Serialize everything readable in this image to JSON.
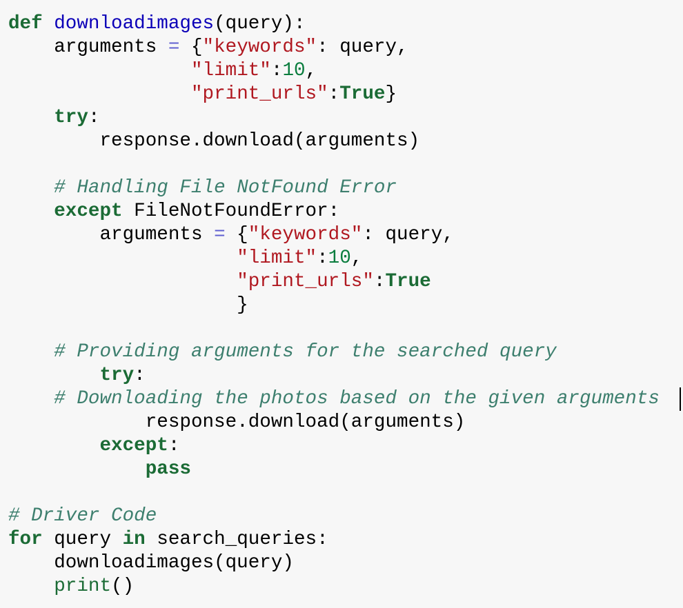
{
  "code_lines": [
    [
      {
        "t": "def",
        "c": "kw"
      },
      {
        "t": " "
      },
      {
        "t": "downloadimages",
        "c": "fn"
      },
      {
        "t": "(query):"
      }
    ],
    [
      {
        "t": "    arguments "
      },
      {
        "t": "=",
        "c": "op"
      },
      {
        "t": " {"
      },
      {
        "t": "\"keywords\"",
        "c": "str"
      },
      {
        "t": ": query,"
      }
    ],
    [
      {
        "t": "                "
      },
      {
        "t": "\"limit\"",
        "c": "str"
      },
      {
        "t": ":"
      },
      {
        "t": "10",
        "c": "num"
      },
      {
        "t": ","
      }
    ],
    [
      {
        "t": "                "
      },
      {
        "t": "\"print_urls\"",
        "c": "str"
      },
      {
        "t": ":"
      },
      {
        "t": "True",
        "c": "kw"
      },
      {
        "t": "}"
      }
    ],
    [
      {
        "t": "    "
      },
      {
        "t": "try",
        "c": "kw"
      },
      {
        "t": ":"
      }
    ],
    [
      {
        "t": "        response.download(arguments)"
      }
    ],
    [
      {
        "t": ""
      }
    ],
    [
      {
        "t": "    "
      },
      {
        "t": "# Handling File NotFound Error",
        "c": "cm"
      }
    ],
    [
      {
        "t": "    "
      },
      {
        "t": "except",
        "c": "kw"
      },
      {
        "t": " FileNotFoundError:"
      }
    ],
    [
      {
        "t": "        arguments "
      },
      {
        "t": "=",
        "c": "op"
      },
      {
        "t": " {"
      },
      {
        "t": "\"keywords\"",
        "c": "str"
      },
      {
        "t": ": query,"
      }
    ],
    [
      {
        "t": "                    "
      },
      {
        "t": "\"limit\"",
        "c": "str"
      },
      {
        "t": ":"
      },
      {
        "t": "10",
        "c": "num"
      },
      {
        "t": ","
      }
    ],
    [
      {
        "t": "                    "
      },
      {
        "t": "\"print_urls\"",
        "c": "str"
      },
      {
        "t": ":"
      },
      {
        "t": "True",
        "c": "kw"
      }
    ],
    [
      {
        "t": "                    }"
      }
    ],
    [
      {
        "t": ""
      }
    ],
    [
      {
        "t": "    "
      },
      {
        "t": "# Providing arguments for the searched query",
        "c": "cm"
      }
    ],
    [
      {
        "t": "        "
      },
      {
        "t": "try",
        "c": "kw"
      },
      {
        "t": ":"
      }
    ],
    [
      {
        "t": "    "
      },
      {
        "t": "# Downloading the photos based on the given arguments",
        "c": "cm"
      }
    ],
    [
      {
        "t": "            response.download(arguments)"
      }
    ],
    [
      {
        "t": "        "
      },
      {
        "t": "except",
        "c": "kw"
      },
      {
        "t": ":"
      }
    ],
    [
      {
        "t": "            "
      },
      {
        "t": "pass",
        "c": "kw"
      }
    ],
    [
      {
        "t": ""
      }
    ],
    [
      {
        "t": "# Driver Code",
        "c": "cm"
      }
    ],
    [
      {
        "t": "for",
        "c": "kw"
      },
      {
        "t": " query "
      },
      {
        "t": "in",
        "c": "kw"
      },
      {
        "t": " search_queries:"
      }
    ],
    [
      {
        "t": "    downloadimages(query)"
      }
    ],
    [
      {
        "t": "    "
      },
      {
        "t": "print",
        "c": "bi"
      },
      {
        "t": "()"
      }
    ]
  ]
}
